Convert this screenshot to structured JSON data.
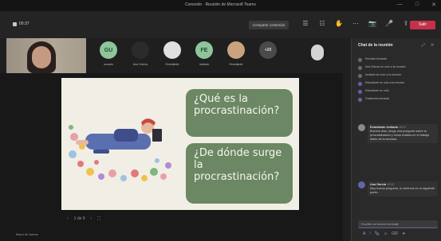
{
  "window": {
    "title": "Conexión · Reunión de Microsoft Teams",
    "controls": [
      "—",
      "□",
      "✕"
    ]
  },
  "meeting": {
    "timer": "00:37",
    "layout_button": "Compartir contenido",
    "tools": [
      "☰",
      "☷",
      "✋",
      "⋯",
      "📷",
      "🎤",
      "⇪"
    ],
    "leave_label": "Salir"
  },
  "participants": [
    {
      "initials": "GU",
      "name": "usuario",
      "kind": "initials"
    },
    {
      "initials": "",
      "name": "Ana García",
      "kind": "photo-dark"
    },
    {
      "initials": "",
      "name": "Estudiante",
      "kind": "photo-light"
    },
    {
      "initials": "FE",
      "name": "Invitado",
      "kind": "initials"
    },
    {
      "initials": "",
      "name": "Estudiante",
      "kind": "photo-light"
    },
    {
      "initials": "+20",
      "name": "",
      "kind": "grey"
    }
  ],
  "slide": {
    "question_1": "¿Qué es la procrastinación?",
    "question_2": "¿De dónde surge la procrastinación?"
  },
  "slide_nav": {
    "prev": "‹",
    "page": "1 de 9",
    "next": "›",
    "extra": "⛶"
  },
  "bottom_label": "Barra de tareas",
  "chat": {
    "title": "Chat de la reunión",
    "header_icons": "⤢ ✕",
    "events": [
      {
        "text": "Reunión iniciada",
        "accent": false
      },
      {
        "text": "Ana García se unió a la reunión",
        "accent": false
      },
      {
        "text": "Invitado se unió a la reunión",
        "accent": false
      },
      {
        "text": "Estudiante se unió a la reunión",
        "accent": true
      },
      {
        "text": "Estudiante se unió",
        "accent": true
      },
      {
        "text": "Grabación iniciada",
        "accent": true
      }
    ],
    "messages": [
      {
        "author": "Estudiante invitado",
        "time": "10:12",
        "body": "Buenos días, tengo una pregunta sobre la procrastinación y cómo evitarla en el trabajo diario de la semana.",
        "accent": false
      },
      {
        "author": "Ana García",
        "time": "10:15",
        "body": "Muy buena pregunta, lo veremos en el siguiente punto.",
        "accent": true
      }
    ],
    "compose_placeholder": "Escribe un nuevo mensaje",
    "compose_tools": [
      "A",
      "!",
      "📎",
      "☺",
      "GIF",
      "➤"
    ]
  }
}
